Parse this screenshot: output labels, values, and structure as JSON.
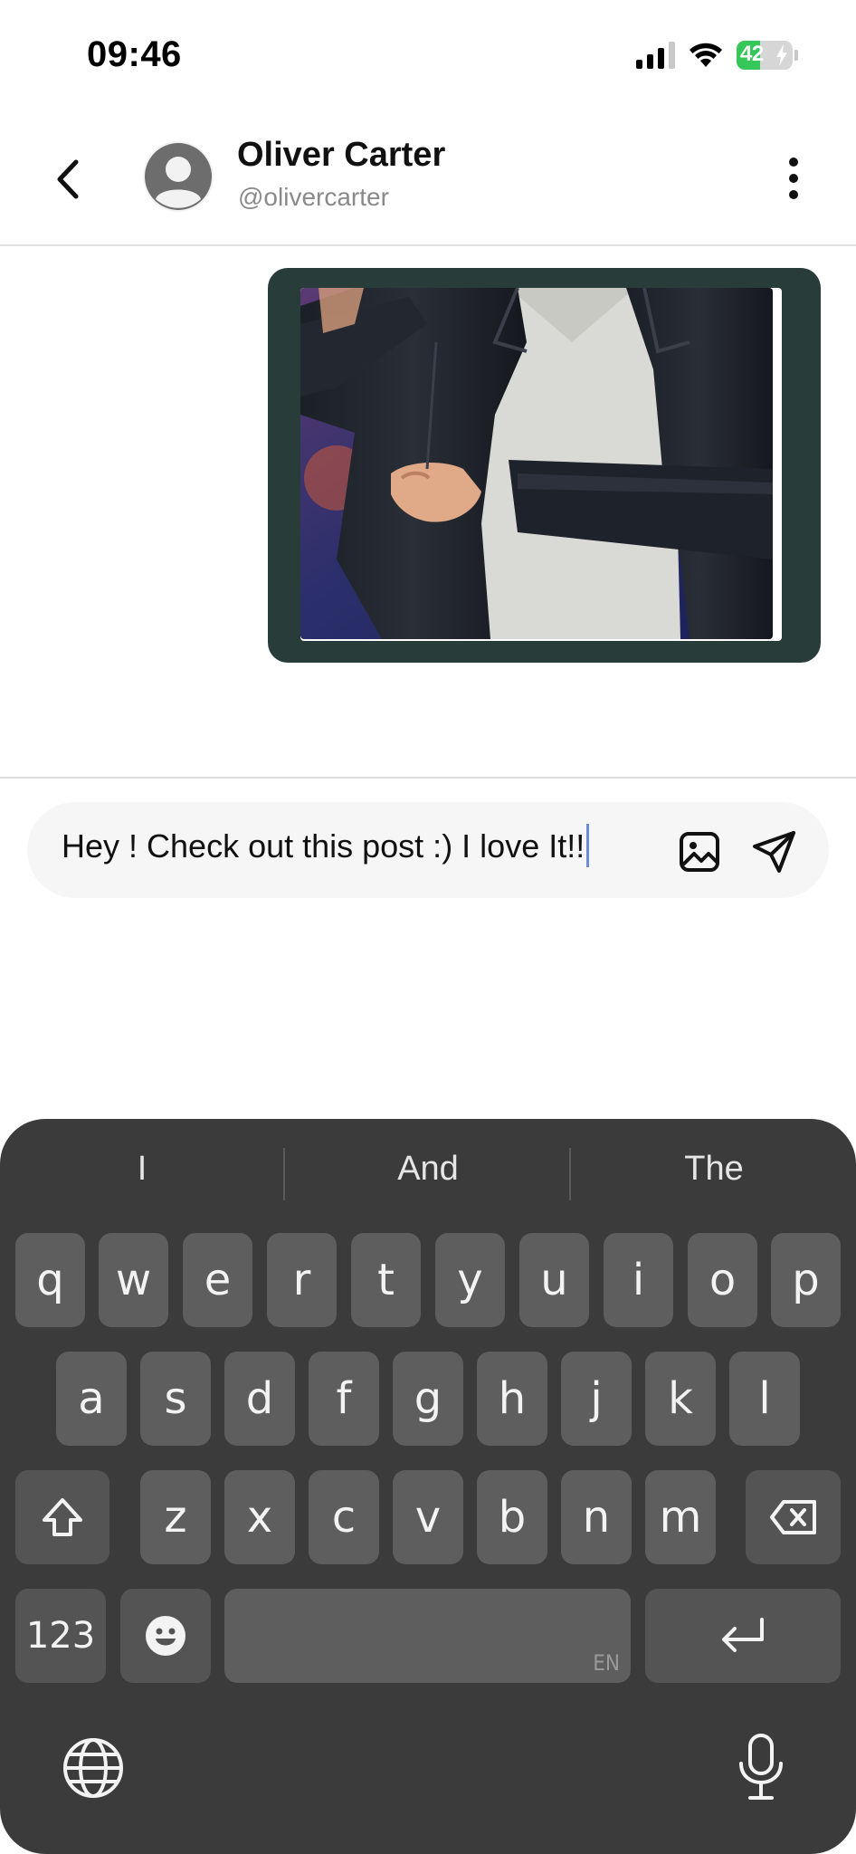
{
  "status_bar": {
    "time": "09:46",
    "battery_level": 42,
    "battery_text": "42",
    "icons": [
      "cellular-signal-icon",
      "wifi-icon",
      "battery-icon",
      "charging-bolt-icon"
    ]
  },
  "header": {
    "contact_name": "Oliver Carter",
    "contact_handle": "@olivercarter",
    "icons": [
      "back-chevron-icon",
      "avatar-placeholder-icon",
      "more-vertical-icon"
    ]
  },
  "messages": [
    {
      "type": "image",
      "sender": "me",
      "description_icon": "photo"
    }
  ],
  "composer": {
    "value": "Hey ! Check out this post :) I love It!!",
    "icons": [
      "image-attach-icon",
      "send-icon"
    ]
  },
  "keyboard": {
    "suggestions": [
      "I",
      "And",
      "The"
    ],
    "row1": [
      "q",
      "w",
      "e",
      "r",
      "t",
      "y",
      "u",
      "i",
      "o",
      "p"
    ],
    "row2": [
      "a",
      "s",
      "d",
      "f",
      "g",
      "h",
      "j",
      "k",
      "l"
    ],
    "row3": [
      "z",
      "x",
      "c",
      "v",
      "b",
      "n",
      "m"
    ],
    "numbers_label": "123",
    "space_lang": "EN",
    "icons": [
      "shift-icon",
      "backspace-icon",
      "emoji-icon",
      "return-icon",
      "globe-icon",
      "microphone-icon"
    ]
  },
  "colors": {
    "image_bubble": "#283d3a",
    "keyboard_bg": "#3b3b3b",
    "key_bg": "#5e5e5e",
    "battery_green": "#35c759",
    "caret": "#6b8bd9"
  }
}
